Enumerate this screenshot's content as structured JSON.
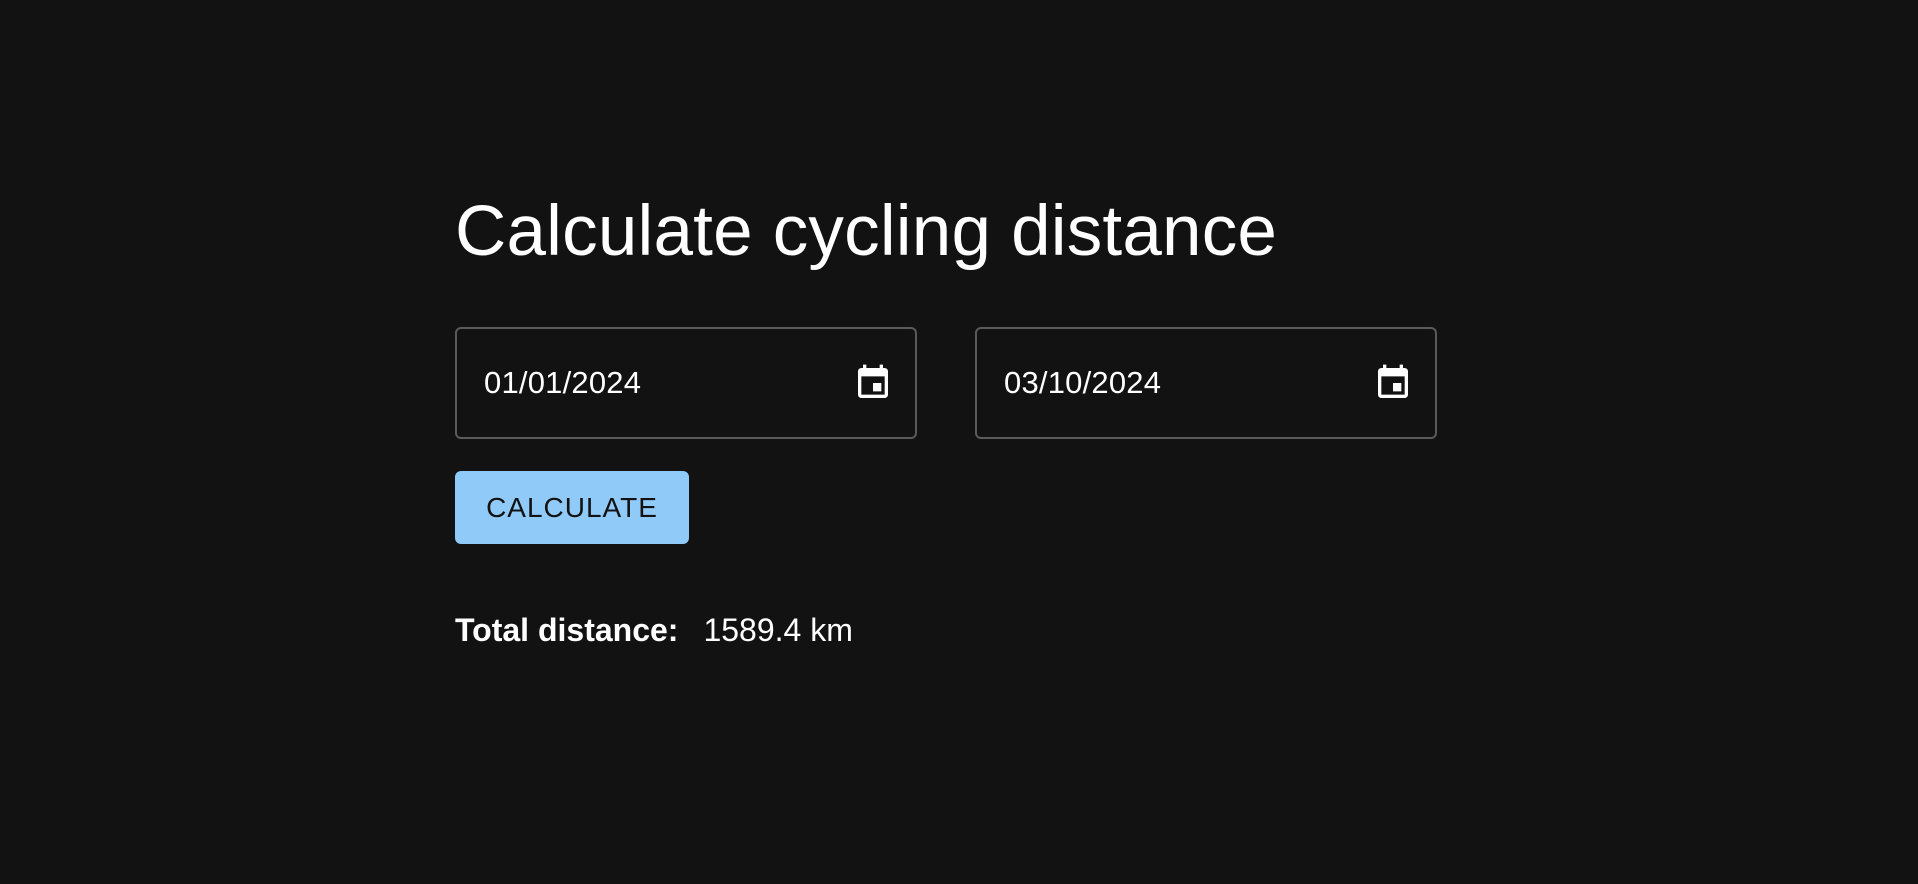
{
  "page": {
    "title": "Calculate cycling distance"
  },
  "form": {
    "start_date": {
      "value": "01/01/2024",
      "icon": "calendar-icon"
    },
    "end_date": {
      "value": "03/10/2024",
      "icon": "calendar-icon"
    },
    "calculate_label": "CALCULATE"
  },
  "result": {
    "label": "Total distance:",
    "value": "1589.4 km"
  },
  "colors": {
    "background": "#121212",
    "accent": "#90caf9",
    "field_border": "#5a5a5a",
    "text": "#ffffff"
  }
}
